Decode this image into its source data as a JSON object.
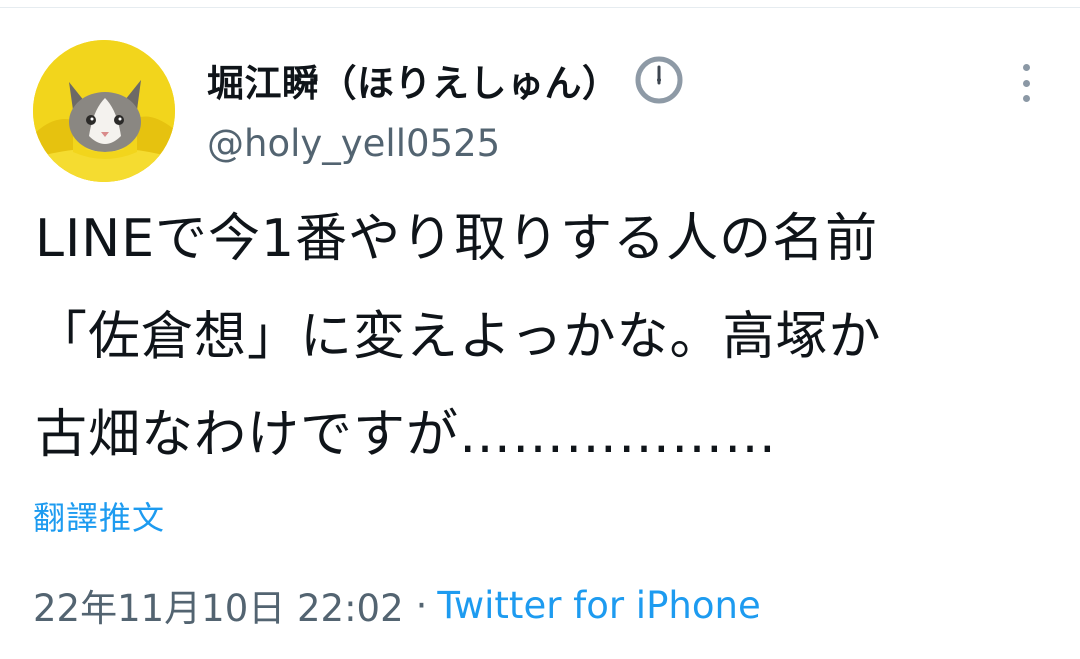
{
  "tweet": {
    "author": {
      "display_name": "堀江瞬（ほりえしゅん）",
      "handle": "@holy_yell0525",
      "badge_icon": "clock-icon"
    },
    "text_lines": [
      "LINEで今1番やり取りする人の名前",
      "「佐倉想」に変えよっかな。高塚か",
      "古畑なわけですが………………"
    ],
    "translate_label": "翻譯推文",
    "timestamp": "22年11月10日 22:02",
    "separator": "·",
    "source": "Twitter for iPhone",
    "more_icon": "more-options-icon"
  },
  "colors": {
    "text": "#0f1419",
    "secondary": "#536471",
    "link": "#1d9bf0",
    "avatar_bg": "#f2d51c"
  }
}
